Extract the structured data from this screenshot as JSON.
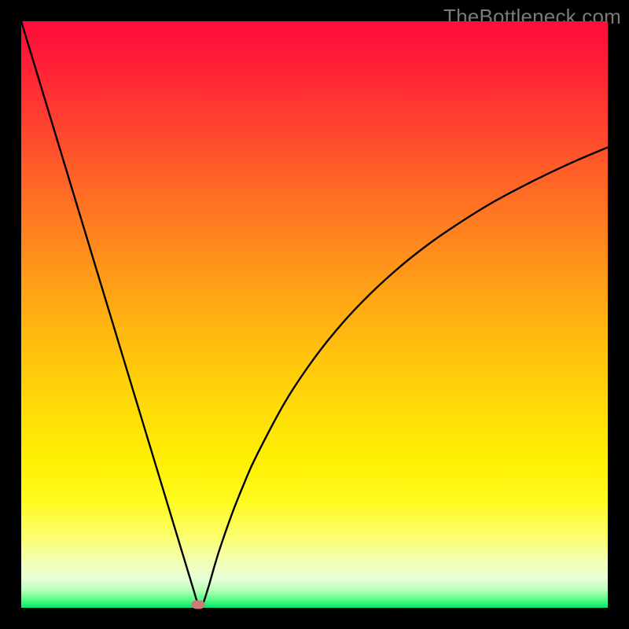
{
  "watermark": "TheBottleneck.com",
  "colors": {
    "background": "#000000",
    "gradient_top": "#ff0d3a",
    "gradient_bottom": "#00e76c",
    "curve": "#000000",
    "marker": "#cd7b76",
    "watermark": "#7a7a7a"
  },
  "chart_data": {
    "type": "line",
    "title": "",
    "xlabel": "",
    "ylabel": "",
    "xlim": [
      0,
      100
    ],
    "ylim": [
      0,
      100
    ],
    "series": [
      {
        "name": "bottleneck-curve",
        "x": [
          0,
          5,
          10,
          15,
          20,
          22,
          24,
          26,
          27,
          28,
          28.5,
          29,
          29.5,
          30,
          30.3,
          30.6,
          31,
          32,
          33,
          34,
          36,
          38,
          40,
          45,
          50,
          55,
          60,
          65,
          70,
          75,
          80,
          85,
          90,
          95,
          100
        ],
        "values": [
          100,
          83.5,
          67,
          50.5,
          34,
          27.4,
          20.8,
          14.2,
          10.9,
          7.6,
          5.95,
          4.3,
          2.65,
          1.0,
          0.5,
          0.2,
          0.7,
          3.8,
          7.3,
          10.5,
          16.2,
          21.2,
          25.7,
          35.1,
          42.6,
          48.8,
          54.0,
          58.5,
          62.4,
          65.8,
          68.9,
          71.6,
          74.1,
          76.4,
          78.5
        ]
      }
    ],
    "annotations": [
      {
        "name": "minimum-marker",
        "x": 30.2,
        "y": 0.6
      }
    ]
  }
}
